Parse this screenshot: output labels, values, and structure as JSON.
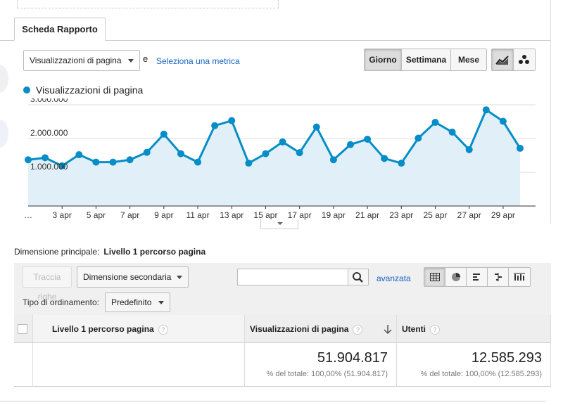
{
  "tab": {
    "label": "Scheda Rapporto"
  },
  "metric_select": {
    "value": "Visualizzazioni di pagina"
  },
  "connector": "e",
  "select_metric_link": "Seleziona una metrica",
  "granularity": {
    "options": [
      "Giorno",
      "Settimana",
      "Mese"
    ],
    "selected": "Giorno"
  },
  "chart_type_icons": [
    "line-chart-icon",
    "motion-chart-icon"
  ],
  "legend": {
    "series": "Visualizzazioni di pagina",
    "color": "#058dc7"
  },
  "chart_data": {
    "type": "area",
    "series": [
      {
        "name": "Visualizzazioni di pagina",
        "values": [
          1370000,
          1430000,
          1190000,
          1520000,
          1300000,
          1300000,
          1370000,
          1590000,
          2130000,
          1550000,
          1300000,
          2380000,
          2530000,
          1270000,
          1550000,
          1900000,
          1580000,
          2340000,
          1370000,
          1820000,
          1980000,
          1410000,
          1270000,
          2010000,
          2480000,
          2190000,
          1670000,
          2850000,
          2510000,
          1710000
        ]
      }
    ],
    "x_tick_labels": [
      "…",
      "3 apr",
      "5 apr",
      "7 apr",
      "9 apr",
      "11 apr",
      "13 apr",
      "15 apr",
      "17 apr",
      "19 apr",
      "21 apr",
      "23 apr",
      "25 apr",
      "27 apr",
      "29 apr"
    ],
    "y_tick_labels": [
      "3.000.000",
      "2.000.000",
      "1.000.000"
    ],
    "y_ticks": [
      3000000,
      2000000,
      1000000
    ],
    "ylim": [
      0,
      3000000
    ],
    "color": "#058dc7",
    "fill": "#e1f0f8"
  },
  "dimension": {
    "label": "Dimensione principale:",
    "value": "Livello 1 percorso pagina"
  },
  "toolbar": {
    "plot_rows": "Traccia righe",
    "secondary_dimension": "Dimensione secondaria",
    "search_placeholder": "",
    "advanced_link": "avanzata",
    "view_icons": [
      "table-view-icon",
      "pie-view-icon",
      "performance-view-icon",
      "comparison-view-icon",
      "pivot-view-icon"
    ]
  },
  "sort": {
    "label": "Tipo di ordinamento:",
    "value": "Predefinito"
  },
  "table": {
    "columns": [
      "Livello 1 percorso pagina",
      "Visualizzazioni di pagina",
      "Utenti"
    ],
    "totals": [
      {
        "value": "51.904.817",
        "note": "% del totale: 100,00% (51.904.817)"
      },
      {
        "value": "12.585.293",
        "note": "% del totale: 100,00% (12.585.293)"
      }
    ]
  }
}
